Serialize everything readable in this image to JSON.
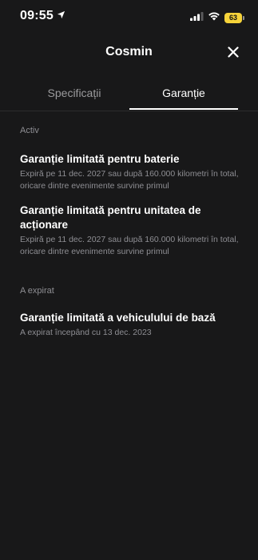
{
  "status_bar": {
    "time": "09:55",
    "battery": "63"
  },
  "header": {
    "title": "Cosmin"
  },
  "tabs": [
    {
      "label": "Specificații",
      "active": false
    },
    {
      "label": "Garanție",
      "active": true
    }
  ],
  "sections": {
    "active": {
      "label": "Activ",
      "items": [
        {
          "title": "Garanție limitată pentru baterie",
          "description": "Expiră pe 11 dec. 2027 sau după 160.000 kilometri în total, oricare dintre evenimente survine primul"
        },
        {
          "title": "Garanție limitată pentru unitatea de acționare",
          "description": "Expiră pe 11 dec. 2027 sau după 160.000 kilometri în total, oricare dintre evenimente survine primul"
        }
      ]
    },
    "expired": {
      "label": "A expirat",
      "items": [
        {
          "title": "Garanție limitată a vehiculului de bază",
          "description": "A expirat începând cu 13 dec. 2023"
        }
      ]
    }
  },
  "colors": {
    "background": "#181819",
    "text_primary": "#ffffff",
    "text_secondary": "#8e8e93",
    "battery_fill": "#f6d33a"
  },
  "icons": {
    "location": "location-arrow-icon",
    "signal": "cellular-signal-icon",
    "wifi": "wifi-icon",
    "battery": "battery-icon",
    "close": "close-icon"
  }
}
